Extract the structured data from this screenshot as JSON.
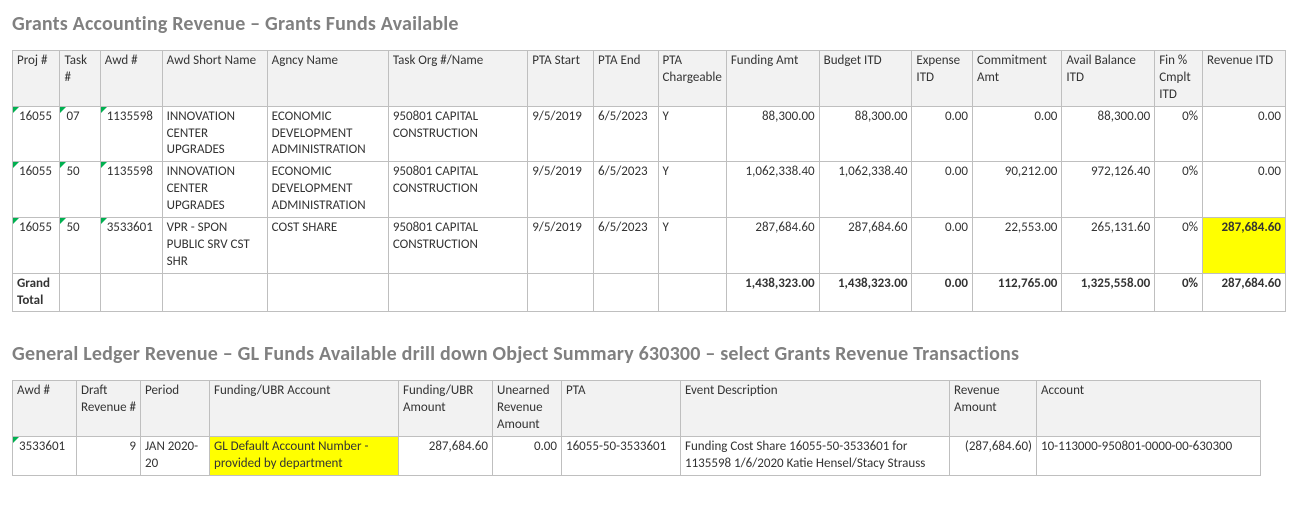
{
  "section1": {
    "title": "Grants Accounting Revenue – Grants Funds Available",
    "headers": [
      "Proj #",
      "Task #",
      "Awd #",
      "Awd Short Name",
      "Agncy Name",
      "Task Org #/Name",
      "PTA Start",
      "PTA End",
      "PTA Chargeable",
      "Funding Amt",
      "Budget ITD",
      "Expense ITD",
      "Commitment Amt",
      "Avail Balance ITD",
      "Fin % Cmplt ITD",
      "Revenue ITD"
    ],
    "rows": [
      {
        "proj": "16055",
        "task": "07",
        "awd": "1135598",
        "awd_short": "INNOVATION CENTER UPGRADES",
        "agncy": "ECONOMIC DEVELOPMENT ADMINISTRATION",
        "task_org": "950801 CAPITAL CONSTRUCTION",
        "pta_start": "9/5/2019",
        "pta_end": "6/5/2023",
        "pta_c": "Y",
        "funding": "88,300.00",
        "budget": "88,300.00",
        "expense": "0.00",
        "commit": "0.00",
        "avail": "88,300.00",
        "fin": "0%",
        "rev": "0.00",
        "rev_highlight": false
      },
      {
        "proj": "16055",
        "task": "50",
        "awd": "1135598",
        "awd_short": "INNOVATION CENTER UPGRADES",
        "agncy": "ECONOMIC DEVELOPMENT ADMINISTRATION",
        "task_org": "950801 CAPITAL CONSTRUCTION",
        "pta_start": "9/5/2019",
        "pta_end": "6/5/2023",
        "pta_c": "Y",
        "funding": "1,062,338.40",
        "budget": "1,062,338.40",
        "expense": "0.00",
        "commit": "90,212.00",
        "avail": "972,126.40",
        "fin": "0%",
        "rev": "0.00",
        "rev_highlight": false
      },
      {
        "proj": "16055",
        "task": "50",
        "awd": "3533601",
        "awd_short": "VPR - SPON PUBLIC SRV CST SHR",
        "agncy": "COST SHARE",
        "task_org": "950801 CAPITAL CONSTRUCTION",
        "pta_start": "9/5/2019",
        "pta_end": "6/5/2023",
        "pta_c": "Y",
        "funding": "287,684.60",
        "budget": "287,684.60",
        "expense": "0.00",
        "commit": "22,553.00",
        "avail": "265,131.60",
        "fin": "0%",
        "rev": "287,684.60",
        "rev_highlight": true
      }
    ],
    "total": {
      "label": "Grand Total",
      "funding": "1,438,323.00",
      "budget": "1,438,323.00",
      "expense": "0.00",
      "commit": "112,765.00",
      "avail": "1,325,558.00",
      "fin": "0%",
      "rev": "287,684.60"
    }
  },
  "section2": {
    "title": "General Ledger Revenue – GL Funds Available drill down Object Summary 630300 – select Grants Revenue Transactions",
    "headers": [
      "Awd #",
      "Draft Revenue #",
      "Period",
      "Funding/UBR Account",
      "Funding/UBR Amount",
      "Unearned Revenue Amount",
      "PTA",
      "Event Description",
      "Revenue Amount",
      "Account"
    ],
    "rows": [
      {
        "awd": "3533601",
        "draft": "9",
        "period": "JAN 2020-20",
        "account_desc": "GL Default Account Number - provided by department",
        "ubr_amt": "287,684.60",
        "unearned": "0.00",
        "pta": "16055-50-3533601",
        "event": "Funding Cost Share 16055-50-3533601 for 1135598 1/6/2020 Katie Hensel/Stacy Strauss",
        "rev_amt": "(287,684.60)",
        "account": "10-113000-950801-0000-00-630300"
      }
    ]
  }
}
